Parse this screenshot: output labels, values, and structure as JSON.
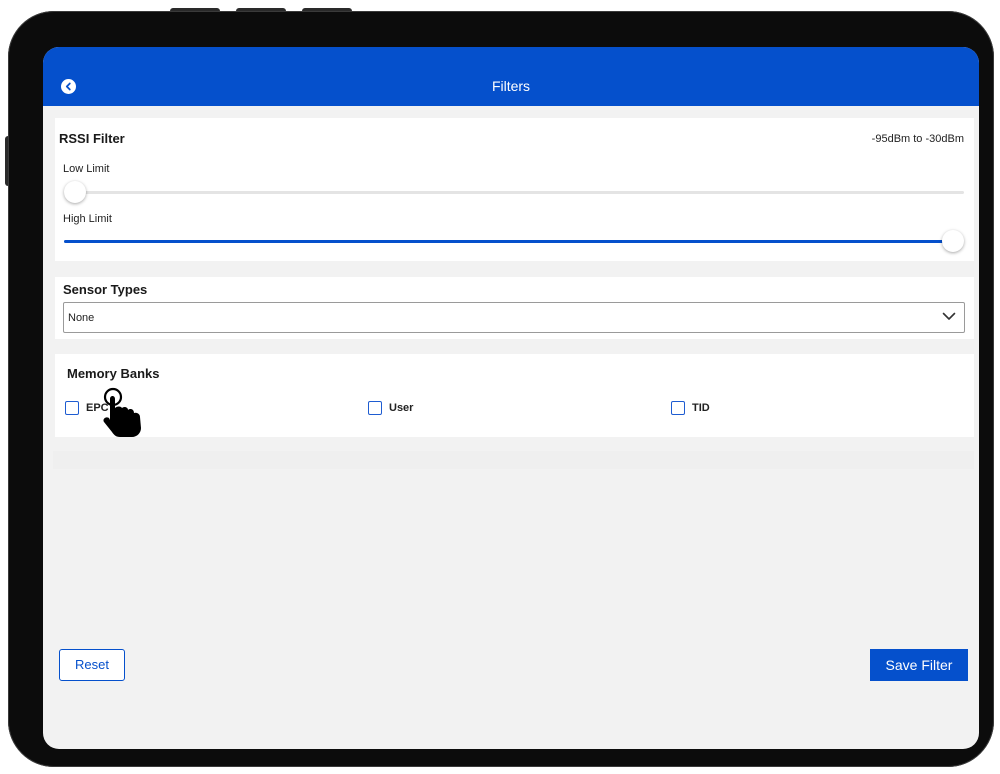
{
  "header": {
    "title": "Filters",
    "back_icon": "chevron-left-circle-icon"
  },
  "rssi_filter": {
    "title": "RSSI Filter",
    "range_text": "-95dBm to -30dBm",
    "low_label": "Low Limit",
    "high_label": "High Limit",
    "low_value_dbm": -95,
    "high_value_dbm": -30,
    "min_dbm": -95,
    "max_dbm": -30
  },
  "sensor_types": {
    "title": "Sensor Types",
    "selected": "None"
  },
  "memory_banks": {
    "title": "Memory Banks",
    "options": [
      {
        "label": "EPC",
        "checked": false
      },
      {
        "label": "User",
        "checked": false
      },
      {
        "label": "TID",
        "checked": false
      }
    ]
  },
  "actions": {
    "reset_label": "Reset",
    "save_label": "Save Filter"
  },
  "colors": {
    "accent": "#0550cc",
    "background": "#f2f2f2",
    "card": "#ffffff"
  }
}
